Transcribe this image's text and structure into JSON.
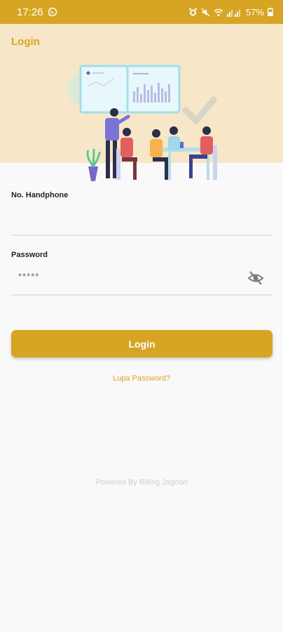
{
  "status_bar": {
    "time": "17:26",
    "battery": "57%",
    "icons": [
      "whatsapp-icon",
      "alarm-icon",
      "mute-icon",
      "wifi-icon",
      "signal-icon",
      "battery-icon"
    ]
  },
  "header": {
    "title": "Login",
    "illustration": "team-meeting-illustration"
  },
  "form": {
    "phone": {
      "label": "No. Handphone",
      "value": ""
    },
    "password": {
      "label": "Password",
      "value": "*****",
      "toggle_icon": "eye-off-icon"
    }
  },
  "login_button": {
    "label": "Login"
  },
  "forgot_password": {
    "label": "Lupa Password?"
  },
  "footer": {
    "text": "Powered By Billing Jagoan"
  },
  "colors": {
    "accent": "#d7a523",
    "header_bg": "#f7e6c8",
    "background": "#f9f9f9"
  }
}
